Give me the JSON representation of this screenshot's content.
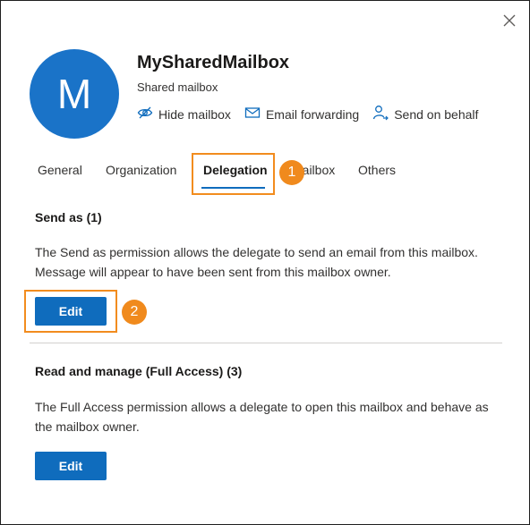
{
  "header": {
    "avatar_letter": "M",
    "title": "MySharedMailbox",
    "subtitle": "Shared mailbox"
  },
  "actions": [
    {
      "label": "Hide mailbox",
      "icon": "hide-eye-icon"
    },
    {
      "label": "Email forwarding",
      "icon": "email-forward-icon"
    },
    {
      "label": "Send on behalf",
      "icon": "person-send-icon"
    }
  ],
  "tabs": [
    {
      "label": "General"
    },
    {
      "label": "Organization"
    },
    {
      "label": "Delegation",
      "active": true
    },
    {
      "label": "Mailbox"
    },
    {
      "label": "Others"
    }
  ],
  "callouts": {
    "first": "1",
    "second": "2"
  },
  "send_as": {
    "title": "Send as (1)",
    "description": "The Send as permission allows the delegate to send an email from this mailbox. Message will appear to have been sent from this mailbox owner.",
    "button": "Edit"
  },
  "full_access": {
    "title": "Read and manage (Full Access) (3)",
    "description": "The Full Access permission allows a delegate to open this mailbox and behave as the mailbox owner.",
    "button": "Edit"
  },
  "colors": {
    "accent": "#0f6cbd",
    "avatar": "#1a73c8",
    "callout": "#f08a1d"
  }
}
